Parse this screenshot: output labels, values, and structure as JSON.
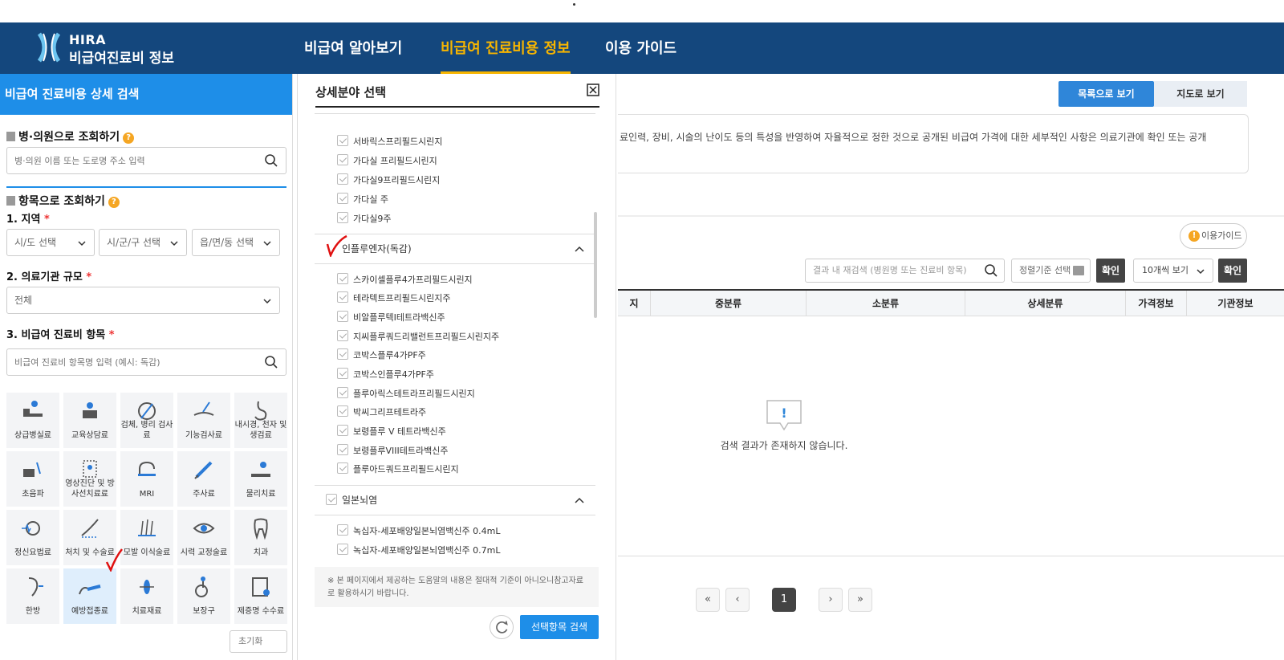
{
  "header": {
    "logo_en": "HIRA",
    "logo_kr": "비급여진료비 정보",
    "nav": [
      "비급여 알아보기",
      "비급여 진료비용 정보",
      "이용 가이드"
    ]
  },
  "left": {
    "title": "비급여 진료비용 상세 검색",
    "hospital_section": "병·의원으로 조회하기",
    "hospital_placeholder": "병·의원 이름 또는 도로명 주소 입력",
    "item_section": "항목으로 조회하기",
    "region_label": "1. 지역",
    "sido": "시/도 선택",
    "sigungu": "시/군/구 선택",
    "eupmyeon": "읍/면/동 선택",
    "scale_label": "2. 의료기관 규모",
    "scale_value": "전체",
    "items_label": "3. 비급여 진료비 항목",
    "items_placeholder": "비급여 진료비 항목명 입력 (예시: 독감)",
    "req": "*",
    "reset": "초기화",
    "categories": [
      {
        "name": "상급병실료"
      },
      {
        "name": "교육상담료"
      },
      {
        "name": "검체, 병리 검사료"
      },
      {
        "name": "기능검사료"
      },
      {
        "name": "내시경, 천자 및 생검료"
      },
      {
        "name": "초음파"
      },
      {
        "name": "영상진단 및 방사선치료료"
      },
      {
        "name": "MRI"
      },
      {
        "name": "주사료"
      },
      {
        "name": "물리치료"
      },
      {
        "name": "정신요법료"
      },
      {
        "name": "처치 및 수술료"
      },
      {
        "name": "모발 이식술료"
      },
      {
        "name": "시력 교정술료"
      },
      {
        "name": "치과"
      },
      {
        "name": "한방"
      },
      {
        "name": "예방접종료"
      },
      {
        "name": "치료재료"
      },
      {
        "name": "보장구"
      },
      {
        "name": "제증명 수수료"
      }
    ]
  },
  "modal": {
    "title": "상세분야 선택",
    "group1_items": [
      "서바릭스프리필드시린지",
      "가다실 프리필드시린지",
      "가다실9프리필드시린지",
      "가다실 주",
      "가다실9주"
    ],
    "group2_title": "인플루엔자(독감)",
    "group2_items": [
      "스카이셀플루4가프리필드시린지",
      "테라텍트프리필드시린지주",
      "비알플루텍I테트라백신주",
      "지씨플루쿼드리밸런트프리필드시린지주",
      "코박스플루4가PF주",
      "코박스인플루4가PF주",
      "플루아릭스테트라프리필드시린지",
      "박씨그리프테트라주",
      "보령플루 V 테트라백신주",
      "보령플루VIII테트라백신주",
      "플루아드쿼드프리필드시린지"
    ],
    "group3_title": "일본뇌염",
    "group3_items": [
      "녹십자-세포배양일본뇌염백신주 0.4mL",
      "녹십자-세포배양일본뇌염백신주 0.7mL"
    ],
    "note": "※ 본 페이지에서 제공하는 도움말의 내용은 절대적 기준이 아니오니참고자료로 활용하시기 바랍니다.",
    "search_btn": "선택항목 검색"
  },
  "right": {
    "view_list": "목록으로 보기",
    "view_map": "지도로 보기",
    "notice": "료인력, 장비, 시술의 난이도 등의 특성을 반영하여 자율적으로 정한 것으로 공개된 비급여 가격에 대한 세부적인 사항은 의료기관에 확인 또는 공개",
    "guide": "이용가이드",
    "result_search_placeholder": "결과 내 재검색 (병원명 또는 진료비 항목)",
    "sort": "정렬기준 선택",
    "confirm": "확인",
    "per_page": "10개씩 보기",
    "columns": [
      "지",
      "중분류",
      "소분류",
      "상세분류",
      "가격정보",
      "기관정보"
    ],
    "empty": "검색 결과가 존재하지 않습니다.",
    "empty_icon": "!",
    "page": "1"
  },
  "colors": {
    "header": "#14477d",
    "accent": "#1e8ee8",
    "active_nav": "#f7b500"
  }
}
